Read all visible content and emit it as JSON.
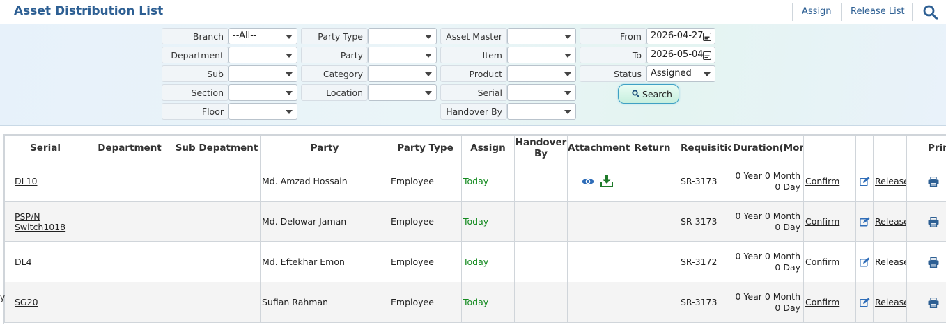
{
  "header": {
    "title": "Asset Distribution List",
    "assign_label": "Assign",
    "release_list_label": "Release List"
  },
  "filters": {
    "branch": {
      "label": "Branch",
      "value": "--All--"
    },
    "department": {
      "label": "Department",
      "value": ""
    },
    "sub": {
      "label": "Sub",
      "value": ""
    },
    "section": {
      "label": "Section",
      "value": ""
    },
    "floor": {
      "label": "Floor",
      "value": ""
    },
    "party_type": {
      "label": "Party Type",
      "value": ""
    },
    "party": {
      "label": "Party",
      "value": ""
    },
    "category": {
      "label": "Category",
      "value": ""
    },
    "location": {
      "label": "Location",
      "value": ""
    },
    "asset_master": {
      "label": "Asset Master",
      "value": ""
    },
    "item": {
      "label": "Item",
      "value": ""
    },
    "product": {
      "label": "Product",
      "value": ""
    },
    "serial": {
      "label": "Serial",
      "value": ""
    },
    "handover_by": {
      "label": "Handover By",
      "value": ""
    },
    "from": {
      "label": "From",
      "value": "2026-04-27"
    },
    "to": {
      "label": "To",
      "value": "2026-05-04"
    },
    "status": {
      "label": "Status",
      "value": "Assigned"
    },
    "search_label": "Search"
  },
  "table": {
    "columns": [
      "Serial",
      "Department",
      "Sub Depatment",
      "Party",
      "Party Type",
      "Assign",
      "Handover By",
      "Attachment",
      "Return",
      "Requisitio",
      "Duration(Mont",
      "",
      "",
      "",
      "Print"
    ],
    "rows": [
      {
        "serial": "DL10",
        "department": "",
        "sub_department": "",
        "party": "Md. Amzad Hossain",
        "party_type": "Employee",
        "assign": "Today",
        "handover_by": "",
        "has_attachment": true,
        "return": "",
        "requisition": "SR-3173",
        "duration_line1": "0 Year 0 Month",
        "duration_line2": "0 Day",
        "confirm": "Confirm",
        "release": "Release"
      },
      {
        "serial": "PSP/N Switch1018",
        "department": "",
        "sub_department": "",
        "party": "Md. Delowar Jaman",
        "party_type": "Employee",
        "assign": "Today",
        "handover_by": "",
        "has_attachment": false,
        "return": "",
        "requisition": "SR-3173",
        "duration_line1": "0 Year 0 Month",
        "duration_line2": "0 Day",
        "confirm": "Confirm",
        "release": "Release"
      },
      {
        "serial": "DL4",
        "department": "",
        "sub_department": "",
        "party": "Md. Eftekhar Emon",
        "party_type": "Employee",
        "assign": "Today",
        "handover_by": "",
        "has_attachment": false,
        "return": "",
        "requisition": "SR-3172",
        "duration_line1": "0 Year 0 Month",
        "duration_line2": "0 Day",
        "confirm": "Confirm",
        "release": "Release"
      },
      {
        "serial": "SG20",
        "department": "",
        "sub_department": "",
        "party": "Sufian Rahman",
        "party_type": "Employee",
        "assign": "Today",
        "handover_by": "",
        "has_attachment": false,
        "return": "",
        "requisition": "SR-3173",
        "duration_line1": "0 Year 0 Month",
        "duration_line2": "0 Day",
        "confirm": "Confirm",
        "release": "Release"
      }
    ],
    "left_fragment": "y"
  },
  "colors": {
    "title": "#2d5f93",
    "today": "#138a1f",
    "icon_blue": "#2f6db8",
    "icon_green": "#1f7a2a"
  }
}
